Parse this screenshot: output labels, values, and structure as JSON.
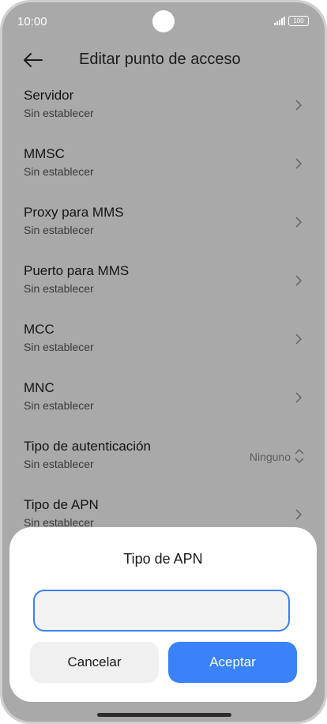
{
  "status_bar": {
    "time": "10:00",
    "battery": "100"
  },
  "header": {
    "title": "Editar punto de acceso",
    "back_icon": "arrow-left-icon"
  },
  "list": {
    "items": [
      {
        "title": "Servidor",
        "subtitle": "Sin establecer"
      },
      {
        "title": "MMSC",
        "subtitle": "Sin establecer"
      },
      {
        "title": "Proxy para MMS",
        "subtitle": "Sin establecer"
      },
      {
        "title": "Puerto para MMS",
        "subtitle": "Sin establecer"
      },
      {
        "title": "MCC",
        "subtitle": "Sin establecer"
      },
      {
        "title": "MNC",
        "subtitle": "Sin establecer"
      },
      {
        "title": "Tipo de autenticación",
        "subtitle": "Sin establecer",
        "value": "Ninguno"
      },
      {
        "title": "Tipo de APN",
        "subtitle": "Sin establecer"
      }
    ]
  },
  "dialog": {
    "title": "Tipo de APN",
    "input_value": "",
    "cancel_label": "Cancelar",
    "accept_label": "Aceptar"
  },
  "colors": {
    "accent": "#3a82f7",
    "overlay_bg": "#a9a9a9",
    "sheet_bg": "#ffffff"
  }
}
